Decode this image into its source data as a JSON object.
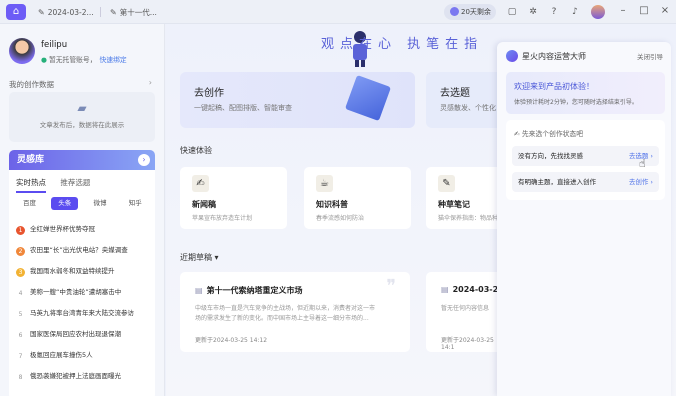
{
  "titlebar": {
    "tabs": [
      {
        "label": "2024-03-2..."
      },
      {
        "label": "第十一代..."
      }
    ],
    "trial": "20天剩余"
  },
  "sidebar": {
    "username": "feilipu",
    "vip_text": "暂无托管账号，",
    "vip_link": "快速绑定",
    "data_title": "我的创作数据",
    "data_empty": "文章发布后，数据将在此展示",
    "insp_title": "灵感库",
    "subtabs": [
      "实时热点",
      "推荐选题"
    ],
    "chips": [
      "百度",
      "头条",
      "微博",
      "知乎"
    ],
    "hot_items": [
      {
        "rank": "1",
        "text": "全红婵世界杯优势夺冠"
      },
      {
        "rank": "2",
        "text": "农田里“长”出光伏电站？央媒调查"
      },
      {
        "rank": "3",
        "text": "我国雨水弱冬和双益特续提升"
      },
      {
        "rank": "4",
        "text": "美称一艘“中贵油轮”遭胡塞击中"
      },
      {
        "rank": "5",
        "text": "马英九将率台湾青年来大陆交流参访"
      },
      {
        "rank": "6",
        "text": "国家医保局回应农村出现退保潮"
      },
      {
        "rank": "7",
        "text": "极氪回应展车撞伤5人"
      },
      {
        "rank": "8",
        "text": "俄恐袭嫌犯被押上法庭画面曝光"
      }
    ]
  },
  "main": {
    "slogan": "观点在心 执笔在指",
    "create": {
      "title": "去创作",
      "desc": "一键起稿、配图排版、智能审查"
    },
    "topic": {
      "title": "去选题",
      "desc": "灵感散发、个性化"
    },
    "quick_title": "快速体验",
    "quick": [
      {
        "title": "新闻稿",
        "desc": "苹果宣布放弃造车计划",
        "icon": "✍"
      },
      {
        "title": "知识科普",
        "desc": "春季流感如何防治",
        "icon": "☕"
      },
      {
        "title": "种草笔记",
        "desc": "猫伞保养指南：物品种草",
        "icon": "✎"
      }
    ],
    "drafts_title": "近期草稿",
    "drafts": [
      {
        "title": "第十一代索纳塔重定义市场",
        "body": "中级车市场一直是汽车竞争的主战场，但近期以来，消费者对这一市场的需求发生了新的变化。而中国市场上主导着这一细分市场的...",
        "updated": "更新于2024-03-25 14:12"
      },
      {
        "title": "2024-03-25",
        "body": "暂无任何内容信息",
        "updated": "更新于2024-03-25 14:1"
      }
    ]
  },
  "panel": {
    "title": "星火内容运营大师",
    "close": "关闭引导",
    "welcome_title": "欢迎来到产品初体验！",
    "welcome_desc": "体验预计耗时2分钟，您可随时选择结束引导。",
    "choose_title": "先来选个创作状态吧",
    "options": [
      {
        "text": "没有方向，先找找灵感",
        "link": "去选题"
      },
      {
        "text": "有明确主题，直接进入创作",
        "link": "去创作"
      }
    ]
  }
}
